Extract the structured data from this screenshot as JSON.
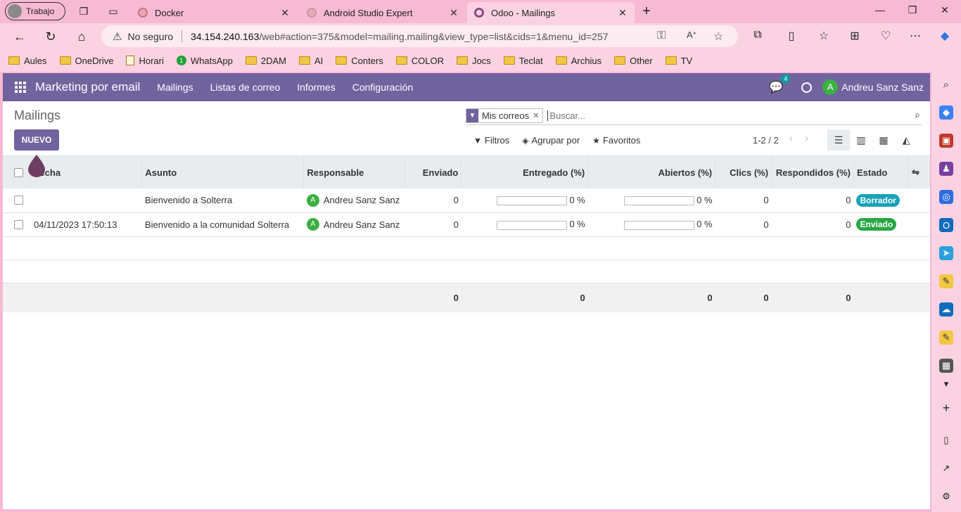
{
  "browser": {
    "profile_label": "Trabajo",
    "tabs": [
      {
        "label": "Docker"
      },
      {
        "label": "Android Studio Expert"
      },
      {
        "label": "Odoo - Mailings"
      }
    ],
    "security_label": "No seguro",
    "url_host": "34.154.240.163",
    "url_path": "/web#action=375&model=mailing.mailing&view_type=list&cids=1&menu_id=257",
    "bookmarks": [
      "Aules",
      "OneDrive",
      "Horari",
      "WhatsApp",
      "2DAM",
      "AI",
      "Conters",
      "COLOR",
      "Jocs",
      "Teclat",
      "Archius",
      "Other",
      "TV"
    ]
  },
  "odoo": {
    "app_name": "Marketing por email",
    "menu": [
      "Mailings",
      "Listas de correo",
      "Informes",
      "Configuración"
    ],
    "chat_count": "4",
    "user_initial": "A",
    "user_name": "Andreu Sanz Sanz",
    "page_title": "Mailings",
    "new_button": "NUEVO",
    "facet_label": "Mis correos",
    "search_placeholder": "Buscar...",
    "filters": "Filtros",
    "group_by": "Agrupar por",
    "favorites": "Favoritos",
    "pager": "1-2 / 2",
    "columns": {
      "fecha": "Fecha",
      "asunto": "Asunto",
      "responsable": "Responsable",
      "enviado": "Enviado",
      "entregado": "Entregado (%)",
      "abiertos": "Abiertos (%)",
      "clics": "Clics (%)",
      "respondidos": "Respondidos (%)",
      "estado": "Estado"
    },
    "rows": [
      {
        "fecha": "",
        "asunto": "Bienvenido a Solterra",
        "responsable": "Andreu Sanz Sanz",
        "enviado": "0",
        "entregado": "0 %",
        "abiertos": "0 %",
        "clics": "0",
        "respondidos": "0",
        "estado": "Borrador",
        "estado_color": "#17a2b8"
      },
      {
        "fecha": "04/11/2023 17:50:13",
        "asunto": "Bienvenido a la comunidad Solterra",
        "responsable": "Andreu Sanz Sanz",
        "enviado": "0",
        "entregado": "0 %",
        "abiertos": "0 %",
        "clics": "0",
        "respondidos": "0",
        "estado": "Enviado",
        "estado_color": "#28a745"
      }
    ],
    "totals": {
      "enviado": "0",
      "entregado": "0",
      "abiertos": "0",
      "clics": "0",
      "respondidos": "0"
    }
  }
}
